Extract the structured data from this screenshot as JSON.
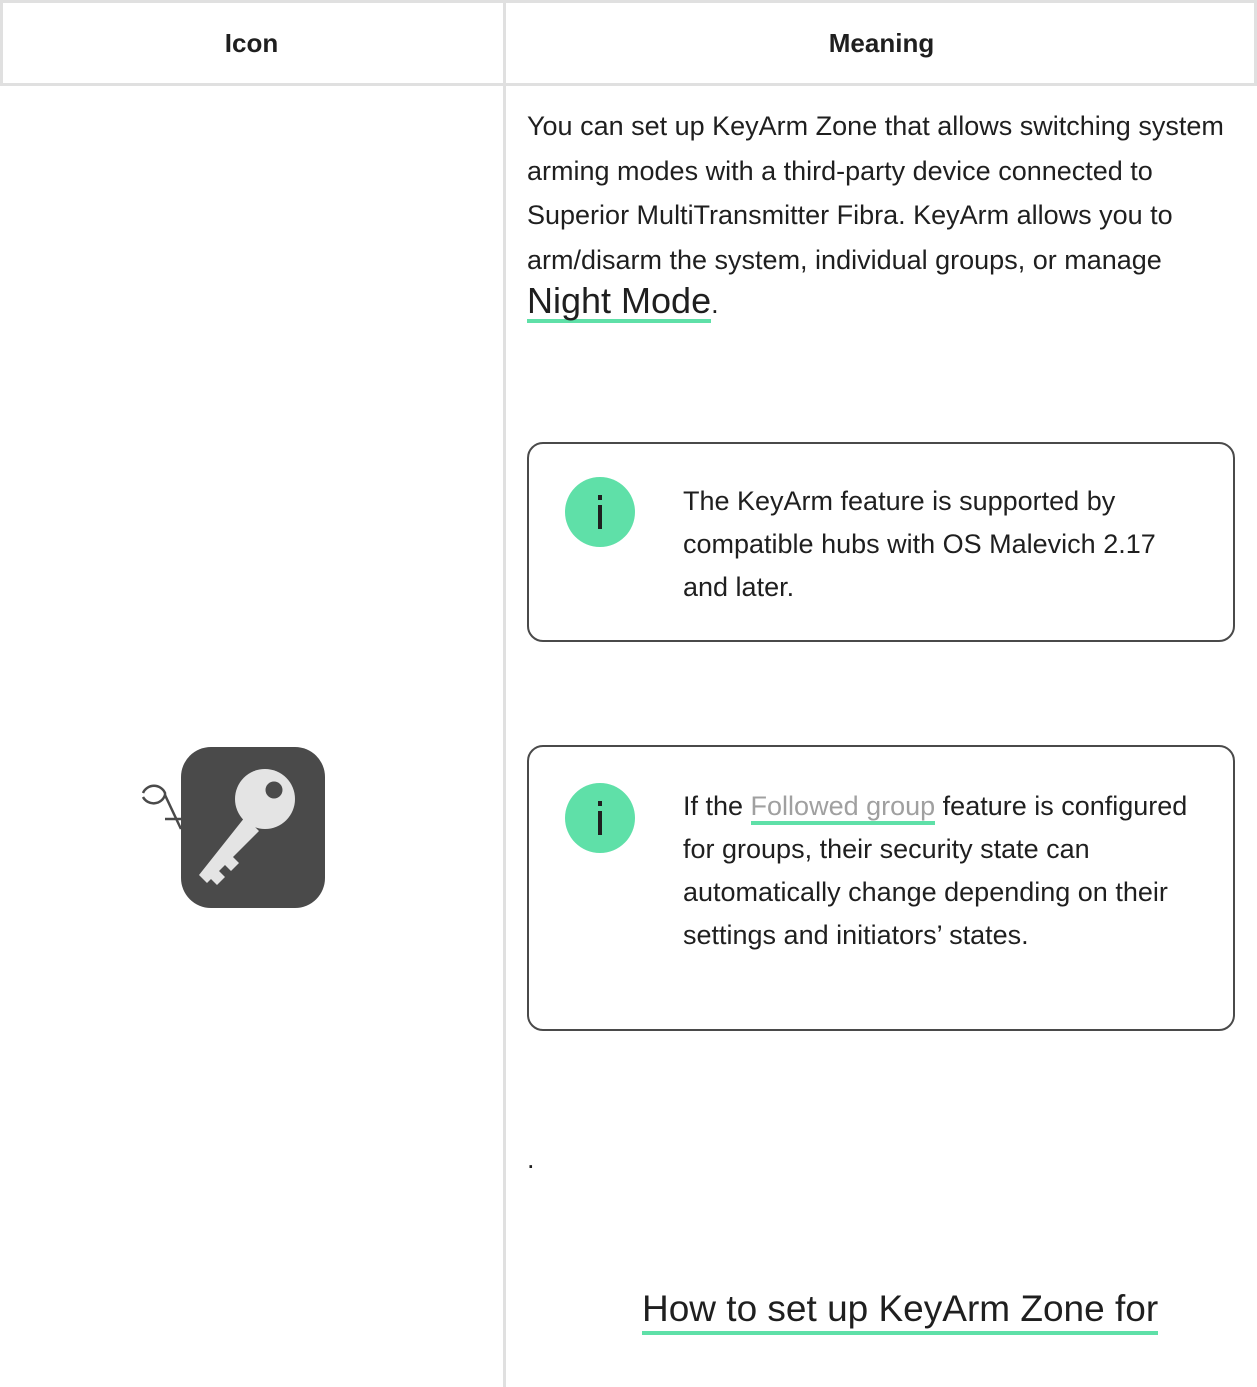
{
  "table": {
    "headers": {
      "icon": "Icon",
      "meaning": "Meaning"
    }
  },
  "row": {
    "icon_name": "keyarm-zone-key-icon",
    "meaning": {
      "intro": "You can set up KeyArm Zone that allows switching system arming modes with a third-party device connected to Superior MultiTransmitter Fibra. KeyArm allows you to arm/disarm the system, individual groups, or manage ",
      "night_mode_link": "Night Mode",
      "intro_end": "."
    },
    "note1": {
      "icon_name": "info-icon",
      "text": "The KeyArm feature is supported by compatible hubs with OS Malevich 2.17 and later."
    },
    "note2": {
      "icon_name": "info-icon",
      "text_before": "If the ",
      "link": "Followed group",
      "text_after": " feature is configured for groups, their security state can automatically change depending on their settings and initiators’ states."
    },
    "trailing_dot": ".",
    "howto_link": "How to set up KeyArm Zone for"
  },
  "colors": {
    "accent_green": "#5fe0a8",
    "icon_dark": "#4a4a4a",
    "grid": "#e0e0e0"
  }
}
